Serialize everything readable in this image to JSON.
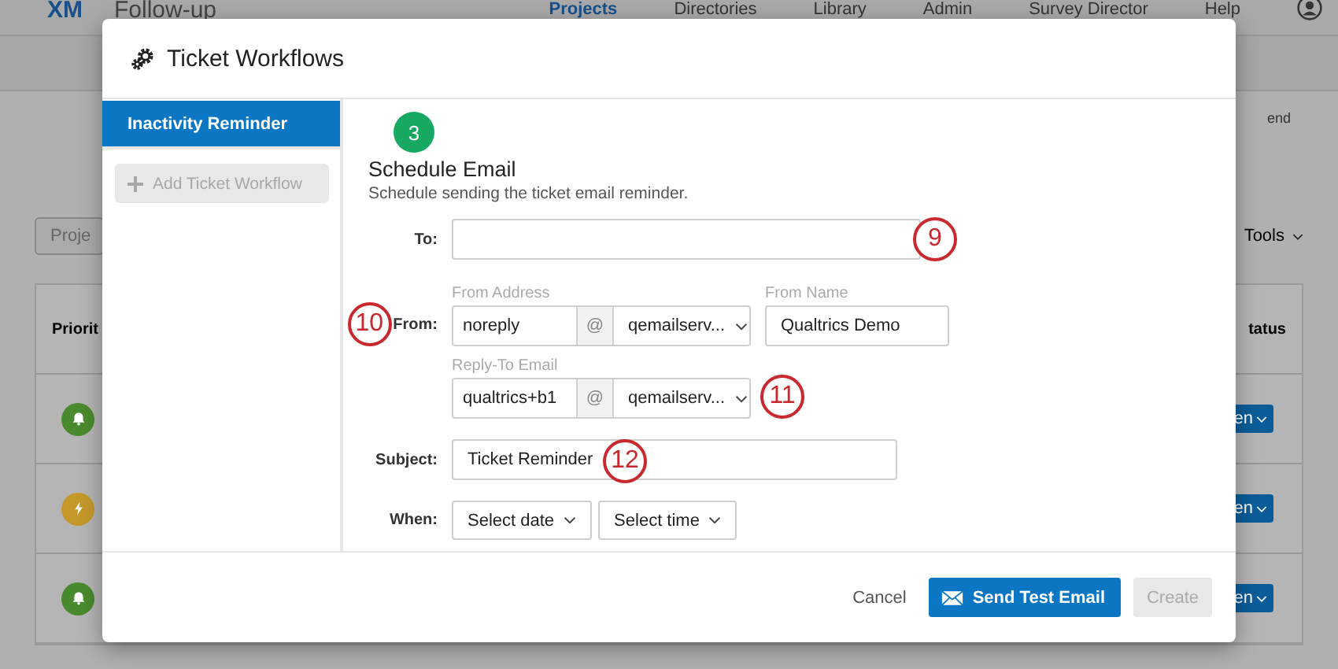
{
  "app": {
    "logo": "XM",
    "title": "Follow-up"
  },
  "nav": [
    {
      "label": "Projects",
      "selected": true
    },
    {
      "label": "Directories",
      "selected": false
    },
    {
      "label": "Library",
      "selected": false
    },
    {
      "label": "Admin",
      "selected": false
    },
    {
      "label": "Survey Director",
      "selected": false
    },
    {
      "label": "Help",
      "selected": false
    }
  ],
  "background": {
    "side_text": "end",
    "search_placeholder": "Proje",
    "tools": "Tools",
    "columns": [
      "Priorit",
      "tatus"
    ],
    "rows": [
      {
        "kind": "bell",
        "color": "#4a8a2e",
        "action": "en"
      },
      {
        "kind": "bolt",
        "color": "#c4982a",
        "action": "en"
      },
      {
        "kind": "bell",
        "color": "#4a8a2e",
        "action": "en"
      }
    ]
  },
  "modal": {
    "title": "Ticket Workflows",
    "workflows": [
      {
        "label": "Inactivity Reminder",
        "selected": true
      }
    ],
    "add_button": {
      "label": "Add Ticket Workflow",
      "disabled": true
    },
    "step": "3",
    "section_title": "Schedule Email",
    "description": "Schedule sending the ticket email reminder.",
    "to": {
      "label": "To:",
      "callout": "9"
    },
    "from": {
      "label": "From:",
      "callout": "10",
      "address_caption": "From Address",
      "address": "noreply",
      "at": "@",
      "domain": "qemailserv...",
      "name_caption": "From Name",
      "name": "Qualtrics Demo"
    },
    "reply_to": {
      "caption": "Reply-To Email",
      "address": "qualtrics+b1",
      "at": "@",
      "domain": "qemailserv...",
      "callout": "11"
    },
    "subject": {
      "label": "Subject:",
      "value": "Ticket Reminder",
      "callout": "12"
    },
    "when": {
      "label": "When:",
      "date": "Select date",
      "time": "Select time"
    },
    "footer": {
      "cancel": "Cancel",
      "send": "Send Test Email",
      "create": {
        "label": "Create",
        "disabled": true
      }
    }
  }
}
